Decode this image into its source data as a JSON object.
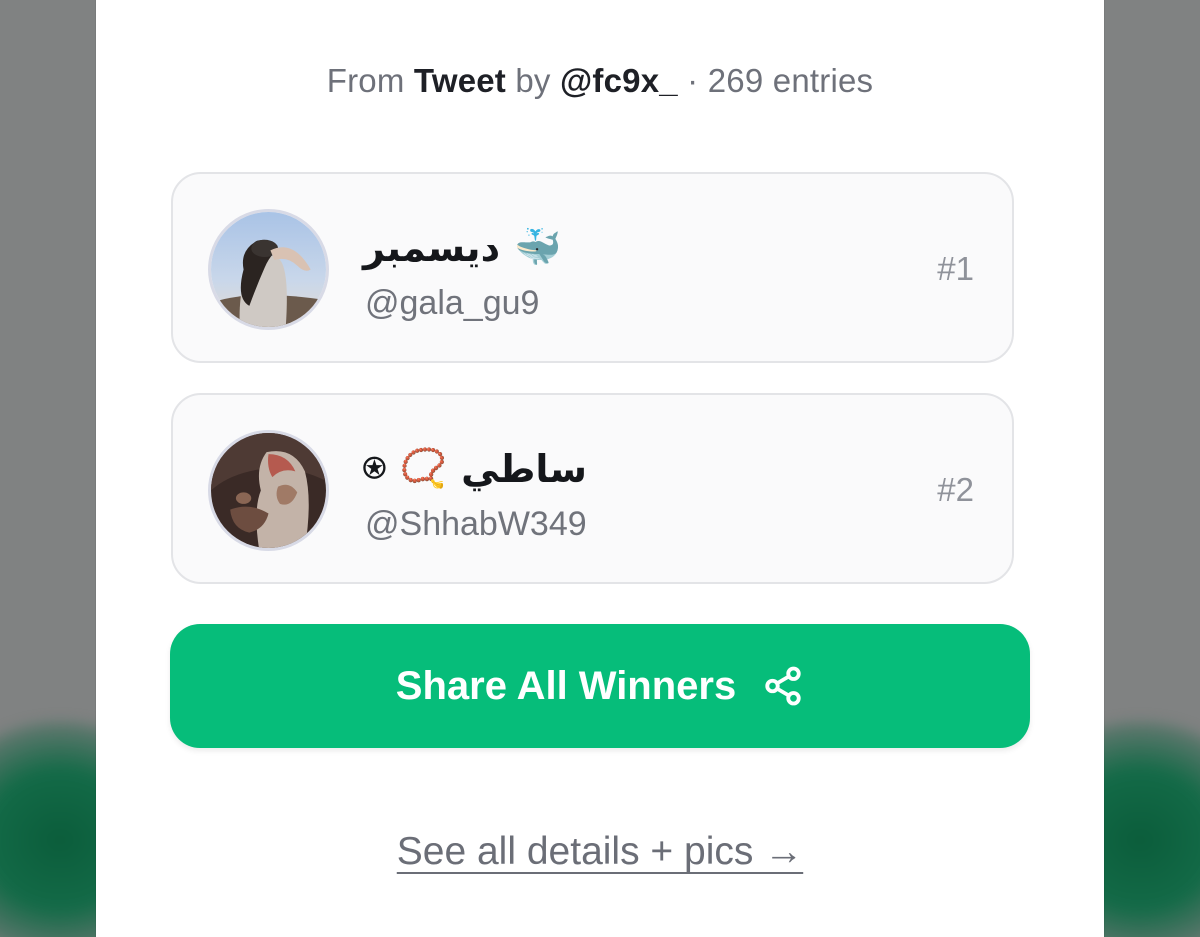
{
  "source": {
    "prefix": "From",
    "platform": "Tweet",
    "by_label": "by",
    "author": "@fc9x_",
    "separator": "·",
    "entries": "269 entries"
  },
  "winners": [
    {
      "display_name": "ديسمبر",
      "emoji": "🐳",
      "handle": "@gala_gu9",
      "rank": "#1"
    },
    {
      "display_name": "ساطي",
      "emoji": "📿",
      "badge": "⍟",
      "handle": "@ShhabW349",
      "rank": "#2"
    }
  ],
  "share_button": {
    "label": "Share All Winners",
    "icon": "share-icon"
  },
  "details_link": {
    "label": "See all details + pics →"
  },
  "colors": {
    "accent": "#06bd7a",
    "card_bg": "#fafafb",
    "muted_text": "#6e717a"
  }
}
